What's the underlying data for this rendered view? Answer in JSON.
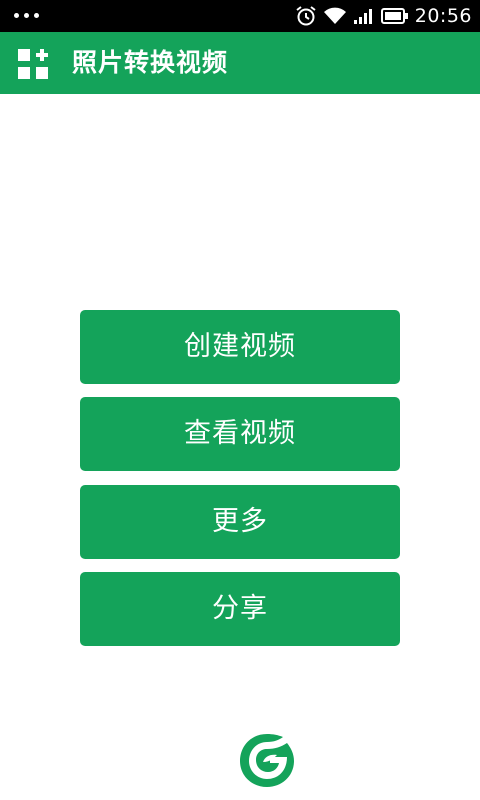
{
  "status_bar": {
    "time": "20:56",
    "icons": [
      "notification-dots-icon",
      "alarm-icon",
      "wifi-icon",
      "signal-icon",
      "battery-icon"
    ]
  },
  "app_bar": {
    "title": "照片转换视频",
    "menu_icon": "grid-menu-icon"
  },
  "buttons": {
    "create": "创建视频",
    "view": "查看视频",
    "more": "更多",
    "share": "分享"
  },
  "colors": {
    "accent": "#14a35a",
    "status_bar": "#000000",
    "background": "#ffffff"
  },
  "footer": {
    "logo_icon": "leaf-g-logo-icon"
  }
}
